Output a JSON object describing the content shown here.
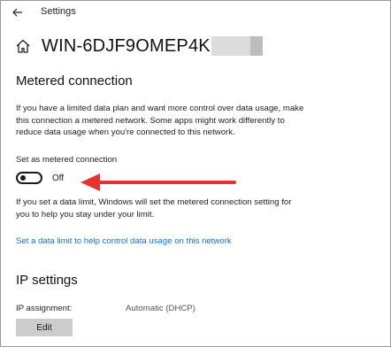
{
  "window": {
    "title": "Settings",
    "back_icon": "back-arrow-icon"
  },
  "header": {
    "home_icon": "home-icon",
    "title": "WIN-6DJF9OMEP4K"
  },
  "metered": {
    "heading": "Metered connection",
    "description": "If you have a limited data plan and want more control over data usage, make this connection a metered network. Some apps might work differently to reduce data usage when you're connected to this network.",
    "toggle_label": "Set as metered connection",
    "toggle_state": "Off",
    "limit_info": "If you set a data limit, Windows will set the metered connection setting for you to help you stay under your limit.",
    "data_limit_link": "Set a data limit to help control data usage on this network"
  },
  "ip": {
    "heading": "IP settings",
    "assignment_label": "IP assignment:",
    "assignment_value": "Automatic (DHCP)",
    "edit_label": "Edit"
  },
  "colors": {
    "link": "#1a6fc2",
    "annotation_arrow": "#e3342f",
    "button_bg": "#cccccc"
  }
}
